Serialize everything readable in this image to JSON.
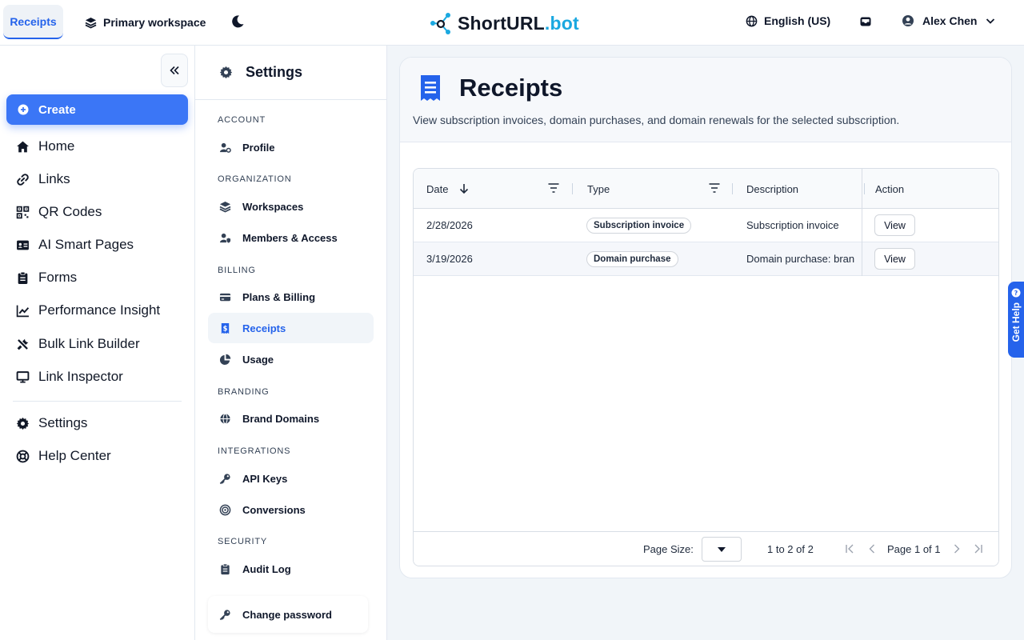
{
  "topbar": {
    "active_tab": "Receipts",
    "workspace": "Primary workspace",
    "logo_part1": "ShortURL",
    "logo_part2": ".bot",
    "language": "English (US)",
    "user_name": "Alex Chen"
  },
  "sidebar": {
    "create_label": "Create",
    "items": [
      {
        "label": "Home",
        "icon": "home-icon"
      },
      {
        "label": "Links",
        "icon": "link-icon"
      },
      {
        "label": "QR Codes",
        "icon": "qr-icon"
      },
      {
        "label": "AI Smart Pages",
        "icon": "id-card-icon"
      },
      {
        "label": "Forms",
        "icon": "clipboard-icon"
      },
      {
        "label": "Performance Insight",
        "icon": "chart-line-icon"
      },
      {
        "label": "Bulk Link Builder",
        "icon": "tools-icon"
      },
      {
        "label": "Link Inspector",
        "icon": "monitor-icon"
      }
    ],
    "bottom_items": [
      {
        "label": "Settings",
        "icon": "gear-icon"
      },
      {
        "label": "Help Center",
        "icon": "lifebuoy-icon"
      }
    ]
  },
  "settings_nav": {
    "title": "Settings",
    "sections": {
      "account": "ACCOUNT",
      "organization": "ORGANIZATION",
      "billing": "BILLING",
      "branding": "BRANDING",
      "integrations": "INTEGRATIONS",
      "security": "SECURITY"
    },
    "items": {
      "profile": "Profile",
      "workspaces": "Workspaces",
      "members": "Members & Access",
      "plans": "Plans & Billing",
      "receipts": "Receipts",
      "usage": "Usage",
      "brand_domains": "Brand Domains",
      "api_keys": "API Keys",
      "conversions": "Conversions",
      "audit_log": "Audit Log",
      "change_password": "Change password"
    }
  },
  "main": {
    "title": "Receipts",
    "subtitle": "View subscription invoices, domain purchases, and domain renewals for the selected subscription.",
    "columns": {
      "date": "Date",
      "type": "Type",
      "description": "Description",
      "action": "Action"
    },
    "rows": [
      {
        "date": "2/28/2026",
        "type": "Subscription invoice",
        "description": "Subscription invoice",
        "action": "View"
      },
      {
        "date": "3/19/2026",
        "type": "Domain purchase",
        "description": "Domain purchase: bran",
        "action": "View"
      }
    ],
    "footer": {
      "page_size_label": "Page Size:",
      "range": "1 to 2 of 2",
      "page_info": "Page 1 of 1"
    }
  },
  "help_tab": "Get Help",
  "colors": {
    "accent": "#2563eb",
    "create_button": "#3b76f6",
    "logo_accent": "#1aa8e0"
  }
}
